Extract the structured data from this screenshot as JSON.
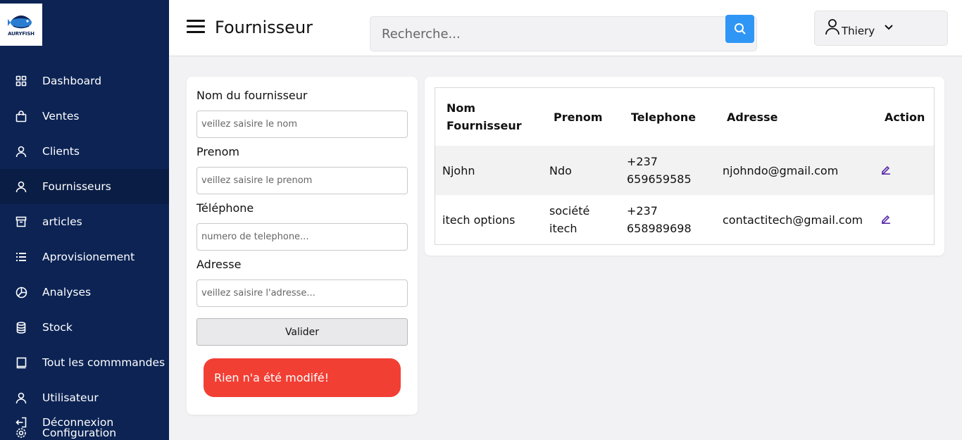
{
  "logo": {
    "text": "AURYFISH"
  },
  "sidebar": {
    "items": [
      {
        "label": "Dashboard",
        "icon": "grid-icon"
      },
      {
        "label": "Ventes",
        "icon": "shopping-bag-icon"
      },
      {
        "label": "Clients",
        "icon": "user-icon"
      },
      {
        "label": "Fournisseurs",
        "icon": "user-icon",
        "active": true
      },
      {
        "label": "articles",
        "icon": "archive-icon"
      },
      {
        "label": "Aprovisionement",
        "icon": "list-icon"
      },
      {
        "label": "Analyses",
        "icon": "pie-chart-icon"
      },
      {
        "label": "Stock",
        "icon": "database-icon"
      },
      {
        "label": "Tout les commmandes",
        "icon": "book-icon"
      },
      {
        "label": "Utilisateur",
        "icon": "user-icon"
      },
      {
        "label": "Déconnexion",
        "icon": "logout-icon"
      },
      {
        "label": "Configuration",
        "icon": "gear-icon"
      }
    ]
  },
  "header": {
    "title": "Fournisseur",
    "search_placeholder": "Recherche...",
    "user_name": "Thiery"
  },
  "form": {
    "name_label": "Nom du fournisseur",
    "name_placeholder": "veillez saisire le nom",
    "prenom_label": "Prenom",
    "prenom_placeholder": "veillez saisire le prenom",
    "phone_label": "Téléphone",
    "phone_placeholder": "numero de telephone...",
    "address_label": "Adresse",
    "address_placeholder": "veillez saisire l'adresse...",
    "submit_label": "Valider",
    "alert_text": "Rien n'a été modifé!"
  },
  "table": {
    "headers": {
      "nom_line1": "Nom",
      "nom_line2": "Fournisseur",
      "prenom": "Prenom",
      "telephone": "Telephone",
      "adresse": "Adresse",
      "action": "Action"
    },
    "rows": [
      {
        "nom": "Njohn",
        "prenom_line1": "Ndo",
        "prenom_line2": "",
        "tel_line1": "+237",
        "tel_line2": "659659585",
        "adresse": "njohndo@gmail.com"
      },
      {
        "nom": "itech options",
        "prenom_line1": "société",
        "prenom_line2": "itech",
        "tel_line1": "+237",
        "tel_line2": "658989698",
        "adresse": "contactitech@gmail.com"
      }
    ]
  },
  "colors": {
    "sidebar_bg": "#0c2354",
    "search_button": "#2f96f5",
    "alert_bg": "#f23f34",
    "edit_icon": "#5b2ca8"
  }
}
